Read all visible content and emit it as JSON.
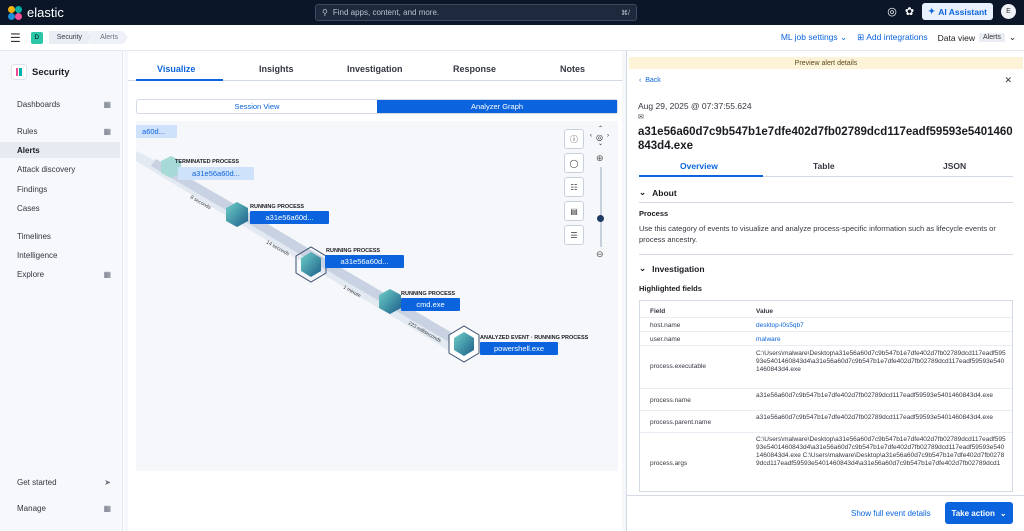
{
  "topbar": {
    "brand": "elastic",
    "search_placeholder": "Find apps, content, and more.",
    "search_shortcut": "⌘/",
    "ai_assistant": "AI Assistant",
    "avatar_initial": "E"
  },
  "crumbbar": {
    "space_initial": "D",
    "crumbs": [
      "Security",
      "Alerts"
    ],
    "ml_job_settings": "ML job settings",
    "add_integrations": "Add integrations",
    "data_view_label": "Data view",
    "data_view_value": "Alerts"
  },
  "sidebar": {
    "title": "Security",
    "items": [
      "Dashboards",
      "Rules",
      "Alerts",
      "Attack discovery",
      "Findings",
      "Cases",
      "Timelines",
      "Intelligence",
      "Explore"
    ],
    "bottom": [
      "Get started",
      "Manage"
    ]
  },
  "main": {
    "tabs": [
      "Visualize",
      "Insights",
      "Investigation",
      "Response",
      "Notes"
    ],
    "segments": [
      "Session View",
      "Analyzer Graph"
    ],
    "graph": {
      "partial_node": "a60d...",
      "nodes": [
        {
          "type": "TERMINATED PROCESS",
          "name": "a31e56a60d..."
        },
        {
          "type": "RUNNING PROCESS",
          "name": "a31e56a60d..."
        },
        {
          "type": "RUNNING PROCESS",
          "name": "a31e56a60d..."
        },
        {
          "type": "RUNNING PROCESS",
          "name": "cmd.exe"
        },
        {
          "type": "ANALYZED EVENT · RUNNING PROCESS",
          "name": "powershell.exe"
        }
      ],
      "edges": [
        "8 seconds",
        "14 seconds",
        "1 minute",
        "223 milliseconds"
      ]
    }
  },
  "flyout": {
    "banner": "Preview alert details",
    "back": "Back",
    "timestamp": "Aug 29, 2025 @ 07:37:55.624",
    "title": "a31e56a60d7c9b547b1e7dfe402d7fb02789dcd117eadf59593e5401460843d4.exe",
    "tabs": [
      "Overview",
      "Table",
      "JSON"
    ],
    "about_heading": "About",
    "process_heading": "Process",
    "process_text": "Use this category of events to visualize and analyze process-specific information such as lifecycle events or process ancestry.",
    "investigation_heading": "Investigation",
    "highlighted_heading": "Highlighted fields",
    "table_headers": [
      "Field",
      "Value"
    ],
    "rows": [
      {
        "field": "host.name",
        "value": "desktop-l0s5qb7"
      },
      {
        "field": "user.name",
        "value": "malware"
      },
      {
        "field": "process.executable",
        "value": "C:\\Users\\malware\\Desktop\\a31e56a60d7c9b547b1e7dfe402d7fb02789dcd117eadf59593e5401460843d4\\a31e56a60d7c9b547b1e7dfe402d7fb02789dcd117eadf59593e5401460843d4.exe"
      },
      {
        "field": "process.name",
        "value": "a31e56a60d7c9b547b1e7dfe402d7fb02789dcd117eadf59593e5401460843d4.exe"
      },
      {
        "field": "process.parent.name",
        "value": "a31e56a60d7c9b547b1e7dfe402d7fb02789dcd117eadf59593e5401460843d4.exe"
      },
      {
        "field": "process.args",
        "value": "C:\\Users\\malware\\Desktop\\a31e56a60d7c9b547b1e7dfe402d7fb02789dcd117eadf59593e5401460843d4\\a31e56a60d7c9b547b1e7dfe402d7fb02789dcd117eadf59593e5401460843d4.exe C:\\Users\\malware\\Desktop\\a31e56a60d7c9b547b1e7dfe402d7fb02789dcd117eadf59593e5401460843d4\\a31e56a60d7c9b547b1e7dfe402d7fb02789dcd1"
      }
    ],
    "show_full": "Show full event details",
    "take_action": "Take action"
  },
  "colors": {
    "accent": "#0b64dd",
    "topbar": "#0b1628",
    "warning_banner": "#fdf3d8"
  }
}
